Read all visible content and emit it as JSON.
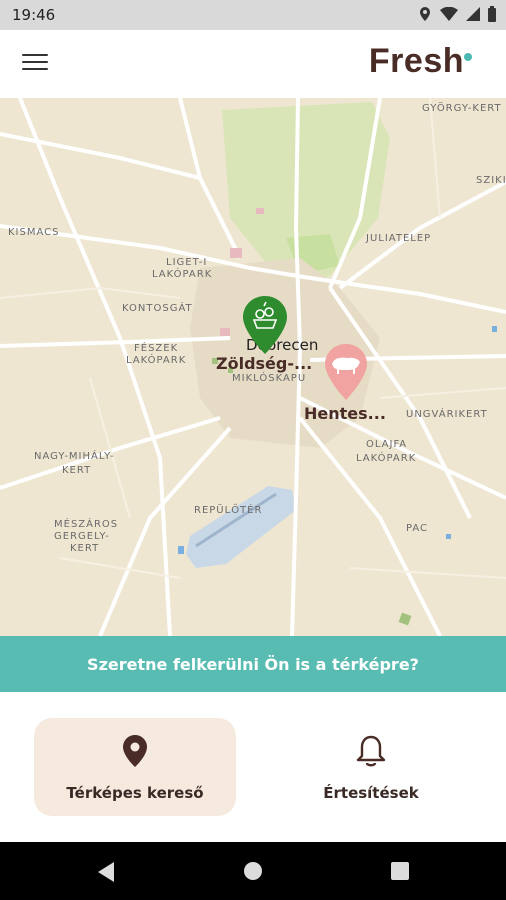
{
  "status_bar": {
    "time": "19:46"
  },
  "app": {
    "logo": "Fresh"
  },
  "map": {
    "places": [
      "GYÖRGY-KERT",
      "SZIKI",
      "KISMACS",
      "JULIATELEP",
      "LIGET-I",
      "LAKÓPARK",
      "KONTOSGÁT",
      "FÉSZEK",
      "LAKÓPARK",
      "MIKLÓSKAPU",
      "UNGVÁRIKERT",
      "OLAJFA",
      "LAKÓPARK",
      "NAGY-MIHÁLY-",
      "KERT",
      "REPÜLŐTÉR",
      "MÉSZÁROS",
      "GERGELY-",
      "KERT",
      "PAC"
    ],
    "city": "Debrecen",
    "pins": [
      {
        "label": "Zöldség-...",
        "color": "#2e8b2e"
      },
      {
        "label": "Hentes...",
        "color": "#f1a3a1"
      }
    ]
  },
  "banner": {
    "text": "Szeretne felkerülni Ön is a térképre?"
  },
  "nav": [
    {
      "label": "Térképes kereső",
      "icon": "location-pin-icon",
      "active": true
    },
    {
      "label": "Értesítések",
      "icon": "bell-icon",
      "active": false
    }
  ],
  "colors": {
    "accent": "#59bcb3",
    "brand": "#4a2c27",
    "active_tab": "#f6eadf"
  }
}
